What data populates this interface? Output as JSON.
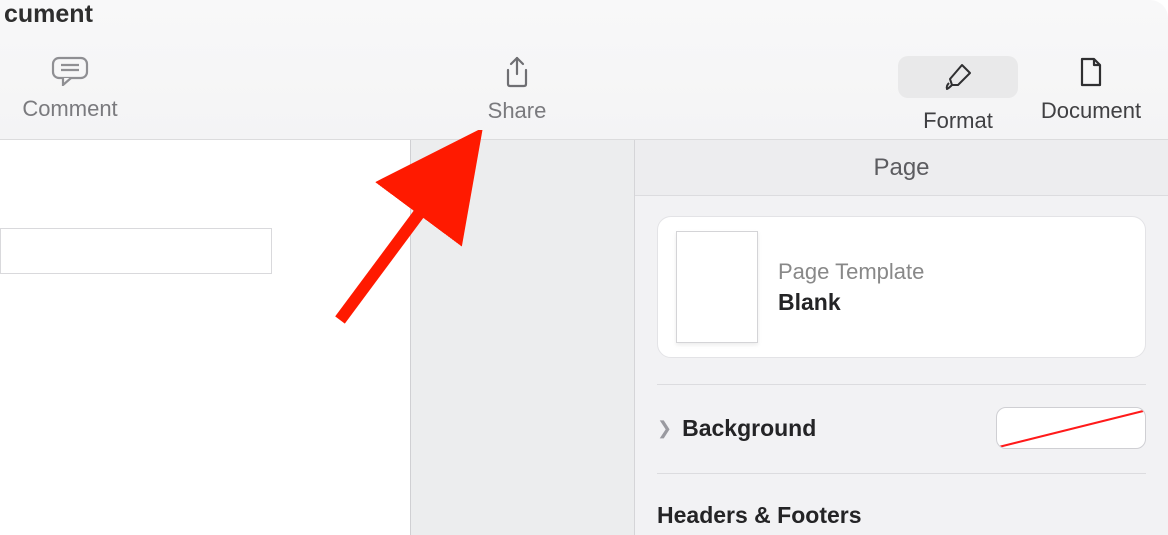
{
  "window": {
    "title_fragment": "cument"
  },
  "toolbar": {
    "comment_label": "Comment",
    "share_label": "Share",
    "format_label": "Format",
    "document_label": "Document"
  },
  "inspector": {
    "header": "Page",
    "template": {
      "label": "Page Template",
      "value": "Blank"
    },
    "background_label": "Background",
    "headers_footers_label": "Headers & Footers"
  }
}
